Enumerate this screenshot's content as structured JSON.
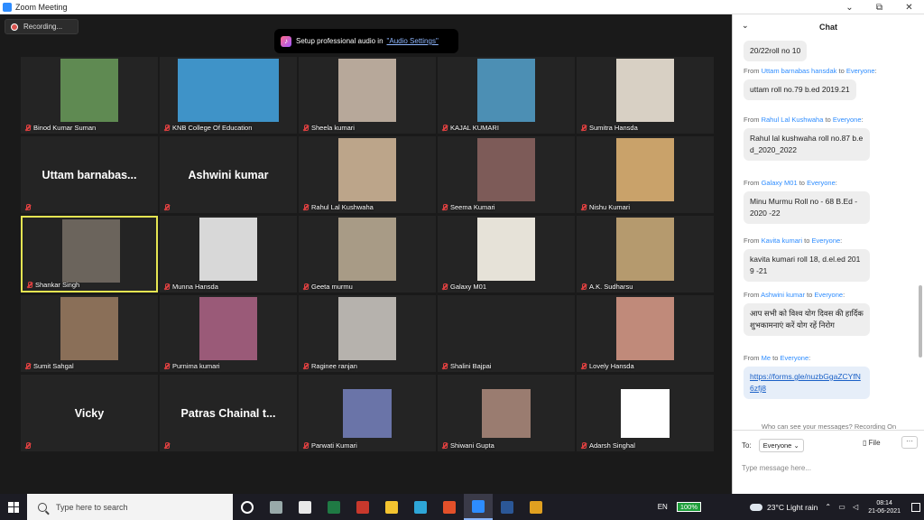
{
  "window": {
    "title": "Zoom Meeting",
    "controls": [
      "⌄",
      "⧉",
      "✕"
    ]
  },
  "meeting": {
    "recording_label": "Recording...",
    "audio_banner": {
      "text": "Setup professional audio in",
      "link": "\"Audio Settings\""
    }
  },
  "participants": [
    {
      "name": "Binod Kumar Suman",
      "row": 0,
      "col": 0,
      "video": true,
      "color": "#5f8a52"
    },
    {
      "name": "KNB College Of Education",
      "row": 0,
      "col": 1,
      "video": true,
      "color": "#3f93c8"
    },
    {
      "name": "Sheela kumari",
      "row": 0,
      "col": 2,
      "video": true,
      "color": "#b7a89a"
    },
    {
      "name": "KAJAL KUMARI",
      "row": 0,
      "col": 3,
      "video": true,
      "color": "#4c8fb4"
    },
    {
      "name": "Sumitra Hansda",
      "row": 0,
      "col": 4,
      "video": true,
      "color": "#d8d0c4"
    },
    {
      "name": "Uttam barnabas...",
      "row": 1,
      "col": 0,
      "video": false
    },
    {
      "name": "Ashwini kumar",
      "row": 1,
      "col": 1,
      "video": false
    },
    {
      "name": "Rahul Lal Kushwaha",
      "row": 1,
      "col": 2,
      "video": true,
      "color": "#bca58a"
    },
    {
      "name": "Seema Kumari",
      "row": 1,
      "col": 3,
      "video": true,
      "color": "#7d5b58"
    },
    {
      "name": "Nishu Kumari",
      "row": 1,
      "col": 4,
      "video": true,
      "color": "#c9a26a"
    },
    {
      "name": "Shankar Singh",
      "row": 2,
      "col": 0,
      "video": true,
      "color": "#6b645c",
      "active": true
    },
    {
      "name": "Munna Hansda",
      "row": 2,
      "col": 1,
      "video": true,
      "color": "#d8d8d8"
    },
    {
      "name": "Geeta murmu",
      "row": 2,
      "col": 2,
      "video": true,
      "color": "#a89b86"
    },
    {
      "name": "Galaxy M01",
      "row": 2,
      "col": 3,
      "video": true,
      "color": "#e6e2d8"
    },
    {
      "name": "A.K. Sudharsu",
      "row": 2,
      "col": 4,
      "video": true,
      "color": "#b59a6e"
    },
    {
      "name": "Sumit Sahgal",
      "row": 3,
      "col": 0,
      "video": true,
      "color": "#8a6f58"
    },
    {
      "name": "Purnima kumari",
      "row": 3,
      "col": 1,
      "video": true,
      "color": "#9a5a78"
    },
    {
      "name": "Raginee ranjan",
      "row": 3,
      "col": 2,
      "video": true,
      "color": "#b6b2ad"
    },
    {
      "name": "Shalini Bajpai",
      "row": 3,
      "col": 3,
      "video": false
    },
    {
      "name": "Lovely Hansda",
      "row": 3,
      "col": 4,
      "video": true,
      "color": "#c08a7a"
    },
    {
      "name": "Vicky",
      "row": 4,
      "col": 0,
      "video": false,
      "big_name": "Vicky"
    },
    {
      "name": "Patras Chainal t...",
      "row": 4,
      "col": 1,
      "video": false,
      "big_name": "Patras Chainal t..."
    },
    {
      "name": "Parwati Kumari",
      "row": 4,
      "col": 2,
      "video": true,
      "color": "#6a74a8"
    },
    {
      "name": "Shiwani Gupta",
      "row": 4,
      "col": 3,
      "video": true,
      "color": "#9a7c70"
    },
    {
      "name": "Adarsh Singhal",
      "row": 4,
      "col": 4,
      "video": true,
      "color": "#ffffff"
    }
  ],
  "chat": {
    "title": "Chat",
    "messages": [
      {
        "from": "",
        "to": "",
        "text": "20/22roll no 10",
        "top": 0
      },
      {
        "from": "Uttam barnabas hansdak",
        "to": "Everyone",
        "text": "uttam roll no.79 b.ed 2019.21"
      },
      {
        "from": "Rahul Lal Kushwaha",
        "to": "Everyone",
        "text": "Rahul lal kushwaha roll no.87 b.ed_2020_2022"
      },
      {
        "from": "Galaxy M01",
        "to": "Everyone",
        "text": "Minu Murmu Roll no - 68 B.Ed - 2020 -22"
      },
      {
        "from": "Kavita kumari",
        "to": "Everyone",
        "text": "kavita kumari roll 18, d.el.ed 2019 -21"
      },
      {
        "from": "Ashwini kumar",
        "to": "Everyone",
        "text": "आप सभी को विश्व योग दिवस की हार्दिक शुभकामनाएं करें योग रहें निरोग"
      },
      {
        "from": "Me",
        "to": "Everyone",
        "text": "https://forms.gle/nuzbGgaZCYfN6zfj8",
        "link": true
      }
    ],
    "from_word": "From",
    "to_word": "to",
    "privacy": "Who can see your messages? Recording On",
    "compose": {
      "to_label": "To:",
      "to_value": "Everyone",
      "file_label": "File",
      "placeholder": "Type message here..."
    }
  },
  "taskbar": {
    "search_placeholder": "Type here to search",
    "lang": "EN",
    "battery": "100%",
    "weather": "23°C  Light rain",
    "time": "08:14",
    "date": "21-06-2021",
    "apps": [
      {
        "name": "task-view-icon",
        "color": "#ffffff"
      },
      {
        "name": "widget-icon",
        "color": "#9aa"
      },
      {
        "name": "store-icon",
        "color": "#e8e8e8"
      },
      {
        "name": "excel-icon",
        "color": "#1f7a44"
      },
      {
        "name": "acrobat-icon",
        "color": "#c8382c"
      },
      {
        "name": "file-explorer-icon",
        "color": "#f4c430"
      },
      {
        "name": "edge-icon",
        "color": "#2ea6d8"
      },
      {
        "name": "office-icon",
        "color": "#e3502a"
      },
      {
        "name": "zoom-icon",
        "color": "#2d8cff",
        "active": true
      },
      {
        "name": "word-icon",
        "color": "#2b5797"
      },
      {
        "name": "chrome-icon",
        "color": "#e0a020"
      }
    ]
  }
}
